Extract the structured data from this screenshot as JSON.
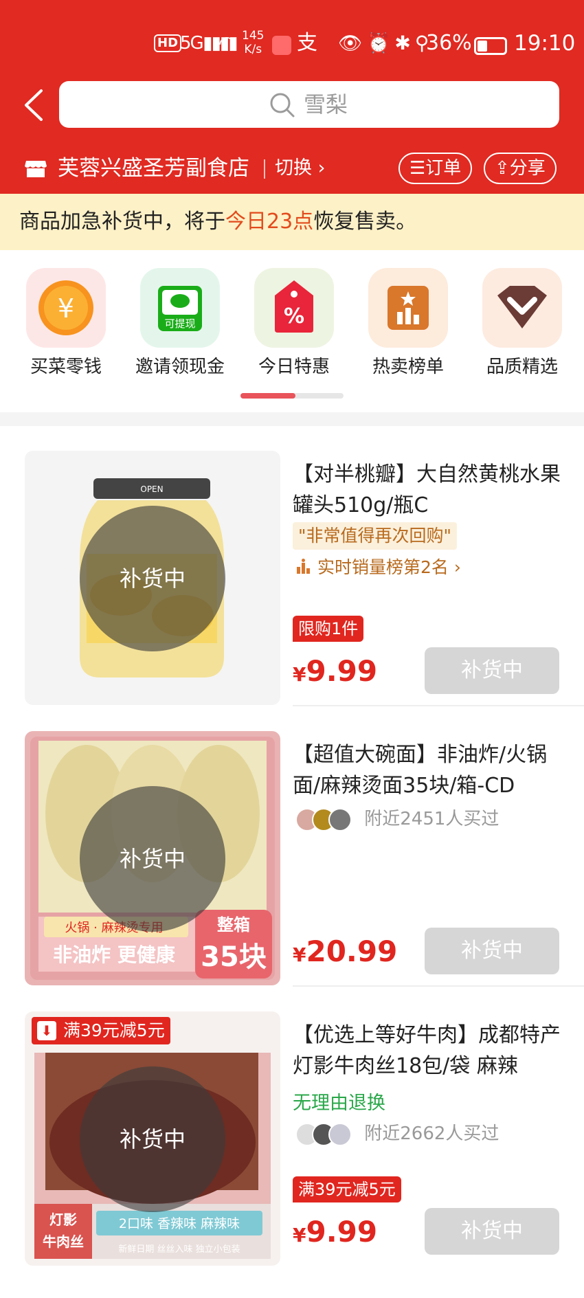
{
  "status_bar": {
    "hd": "HD",
    "signal": "5G ▮▮▮▮",
    "speed": "145\nK/s",
    "alipay": "支",
    "icons": "👁⏰✱⚲",
    "battery": "36%",
    "time": "19:10"
  },
  "search": {
    "placeholder": "雪梨"
  },
  "store": {
    "name": "芙蓉兴盛圣芳副食店",
    "switch_label": "切换 ›",
    "orders_label": "☰订单",
    "share_label": "⇪分享"
  },
  "notice": {
    "prefix": "商品加急补货中，将于",
    "highlight": "今日23点",
    "suffix": "恢复售卖。"
  },
  "categories": [
    {
      "label": "买菜零钱",
      "icon": "yuan-coin-icon",
      "bg": "#fde7e6"
    },
    {
      "label": "邀请领现金",
      "icon": "wechat-cash-icon",
      "bg": "#e4f6ec"
    },
    {
      "label": "今日特惠",
      "icon": "discount-tag-icon",
      "bg": "#eef4e2"
    },
    {
      "label": "热卖榜单",
      "icon": "ranking-icon",
      "bg": "#fdebdc"
    },
    {
      "label": "品质精选",
      "icon": "diamond-icon",
      "bg": "#fdebe0"
    }
  ],
  "category_icon_texts": {
    "yuan": "¥",
    "cash": "可提现",
    "percent": "%"
  },
  "products": [
    {
      "title": "【对半桃瓣】大自然黄桃水果罐头510g/瓶C",
      "quote": "\"非常值得再次回购\"",
      "rank": "实时销量榜第2名 ›",
      "limit": "限购1件",
      "price": "9.99",
      "status": "补货中",
      "image_label": "OPEN"
    },
    {
      "title": "【超值大碗面】非油炸/火锅面/麻辣烫面35块/箱-CD",
      "buyers": "附近2451人买过",
      "price": "20.99",
      "status": "补货中",
      "img_sub": "火锅 · 麻辣烫专用",
      "img_main": "非油炸 更健康",
      "img_box": "整箱",
      "img_count": "35块"
    },
    {
      "title": "【优选上等好牛肉】成都特产 灯影牛肉丝18包/袋 麻辣",
      "return_policy": "无理由退换",
      "buyers": "附近2662人买过",
      "promo": "满39元减5元",
      "price": "9.99",
      "status": "补货中",
      "img_brand": "灯影\n牛肉丝",
      "img_flavors": "2口味 香辣味 麻辣味",
      "img_features": "新鲜日期  丝丝入味  独立小包装"
    }
  ],
  "currency": "¥",
  "colors": {
    "brand_red": "#e02a22",
    "price_red": "#e0261f",
    "notice_bg": "#fdf1c7",
    "rank_orange": "#b86a1d",
    "green": "#2aa74a"
  }
}
